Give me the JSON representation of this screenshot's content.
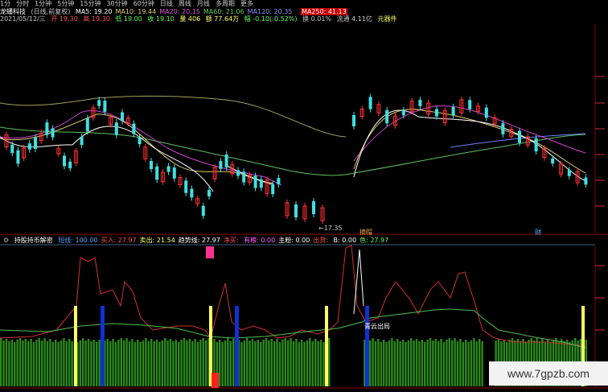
{
  "period_tabs": [
    "1分",
    "分时",
    "1分钟",
    "5分钟",
    "15分钟",
    "30分钟",
    "60分钟",
    "日线",
    "周线",
    "月线",
    "多周期",
    "更多"
  ],
  "stock": {
    "name": "龙蟠科技",
    "adjust": "(日线,前复权)"
  },
  "ma": [
    {
      "label": "MA5: 19.20",
      "color": "#ffffff"
    },
    {
      "label": "MA10: 19.44",
      "color": "#e0d070"
    },
    {
      "label": "MA20: 20.15",
      "color": "#e050e0"
    },
    {
      "label": "MA60: 21.06",
      "color": "#60d060"
    },
    {
      "label": "MA120: 20.35",
      "color": "#9090ff"
    }
  ],
  "ma_hidden": "MA250: 41.13",
  "quote": {
    "date": "2021/05/12/三",
    "open": "开 19.30",
    "high": "高 19.30",
    "low": "低 19.00",
    "close": "收 19.10",
    "volume": "量 406",
    "amount": "额 77.64万",
    "change": "幅 -0.10(-0.52%)",
    "turnover": "换 0.01%",
    "float_cap": "流通 4.11亿",
    "sector": "元器件"
  },
  "markers": {
    "low_price": "←17.35",
    "event1": "摘帽",
    "event2": "财"
  },
  "indicator": {
    "name": "持股持币解密",
    "params": [
      {
        "label": "短线: 100.00",
        "color": "#5aa0ff"
      },
      {
        "label": "买入: 27.97",
        "color": "#ff5050"
      },
      {
        "label": "卖出: 21.54",
        "color": "#ffff60"
      },
      {
        "label": "趋势线: 27.97",
        "color": "#ffffff"
      },
      {
        "label": "净买: ",
        "color": "#ff5050"
      },
      {
        "label": "有粮: 0.00",
        "color": "#ff60ff"
      },
      {
        "label": "主粉: 0.00",
        "color": "#ffffff"
      },
      {
        "label": "出货: ",
        "color": "#ff5050"
      },
      {
        "label": "B: 0.00",
        "color": "#ffffff"
      },
      {
        "label": "色: 27.97",
        "color": "#60ff60"
      }
    ],
    "annotation": "青云出局"
  },
  "watermark": "www.7gpzb.com",
  "colors": {
    "up": "#ff3232",
    "down": "#40e0e0",
    "grid": "#8b0000"
  }
}
